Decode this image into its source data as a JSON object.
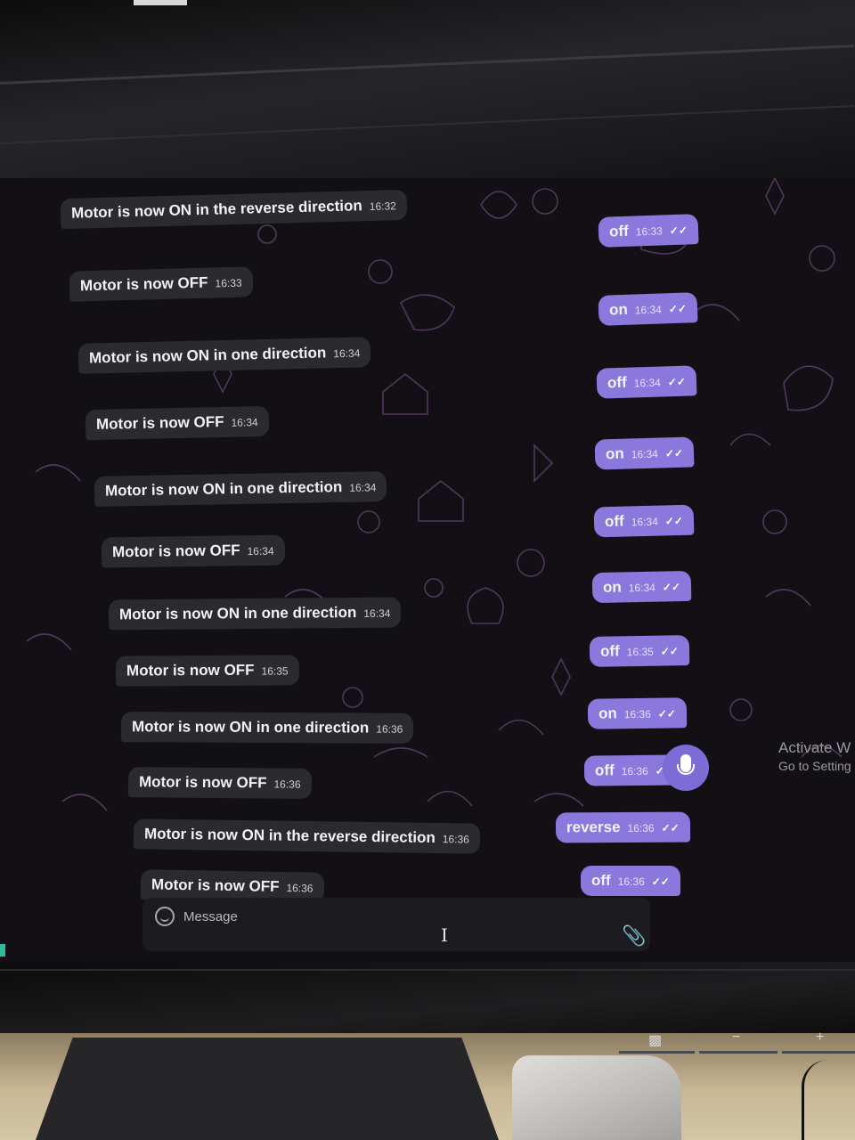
{
  "chat": {
    "incoming": [
      {
        "text": "Motor is now ON in the reverse direction",
        "time": "16:32"
      },
      {
        "text": "Motor is now OFF",
        "time": "16:33"
      },
      {
        "text": "Motor is now ON in one direction",
        "time": "16:34"
      },
      {
        "text": "Motor is now OFF",
        "time": "16:34"
      },
      {
        "text": "Motor is now ON in one direction",
        "time": "16:34"
      },
      {
        "text": "Motor is now OFF",
        "time": "16:34"
      },
      {
        "text": "Motor is now ON in one direction",
        "time": "16:34"
      },
      {
        "text": "Motor is now OFF",
        "time": "16:35"
      },
      {
        "text": "Motor is now ON in one direction",
        "time": "16:36"
      },
      {
        "text": "Motor is now OFF",
        "time": "16:36"
      },
      {
        "text": "Motor is now ON in the reverse direction",
        "time": "16:36"
      },
      {
        "text": "Motor is now OFF",
        "time": "16:36"
      }
    ],
    "outgoing": [
      {
        "text": "off",
        "time": "16:33",
        "status": "read"
      },
      {
        "text": "on",
        "time": "16:34",
        "status": "read"
      },
      {
        "text": "off",
        "time": "16:34",
        "status": "read"
      },
      {
        "text": "on",
        "time": "16:34",
        "status": "read"
      },
      {
        "text": "off",
        "time": "16:34",
        "status": "read"
      },
      {
        "text": "on",
        "time": "16:34",
        "status": "read"
      },
      {
        "text": "off",
        "time": "16:35",
        "status": "read"
      },
      {
        "text": "on",
        "time": "16:36",
        "status": "read"
      },
      {
        "text": "off",
        "time": "16:36",
        "status": "read"
      },
      {
        "text": "reverse",
        "time": "16:36",
        "status": "read"
      },
      {
        "text": "off",
        "time": "16:36",
        "status": "read"
      }
    ],
    "read_checks": "✓✓"
  },
  "composer": {
    "placeholder": "Message",
    "emoji_icon": "smile-icon",
    "attach_icon": "paperclip-icon",
    "mic_icon": "microphone-icon"
  },
  "watermark": {
    "line1": "Activate W",
    "line2": "Go to Setting"
  },
  "colors": {
    "outgoing_bubble": "#8a78dc",
    "incoming_bubble": "#2b2b2f",
    "accent": "#7d6bd6"
  }
}
